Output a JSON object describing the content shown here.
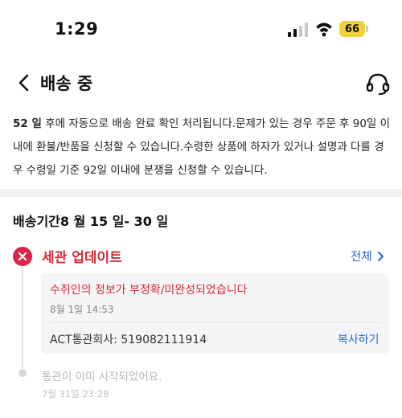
{
  "status_bar": {
    "time": "1:29",
    "battery_level": "66",
    "signal_icon": "cellular-signal-icon",
    "wifi_icon": "wifi-icon",
    "battery_color": "#f1d13c"
  },
  "header": {
    "title": "배송 중",
    "back_icon": "chevron-left-icon",
    "support_icon": "headset-icon"
  },
  "notice": {
    "days_strong": "52 일",
    "text": " 후에 자동으로 배송 완료 확인 처리됩니다.문제가 있는 경우 주문 후 90일 이내에 환불/반품을 신청할 수 있습니다.수령한 상품에 하자가 있거나 설명과 다를 경우 수령일 기준 92일 이내에 분쟁을 신청할 수 있습니다."
  },
  "delivery_period": "배송기간8 월 15 일- 30 일",
  "timeline": {
    "current": {
      "title": "세관 업데이트",
      "view_all": "전체",
      "message": "수취인의 정보가 부정확/미완성되었습니다",
      "date": "8월 1일 14:53",
      "customs_label": "ACT통관회사: 519082111914",
      "copy_label": "복사하기",
      "status_icon": "error-x-icon",
      "accent_color": "#d52b3a"
    },
    "previous": {
      "message": "통관이 이미 시작되었어요.",
      "date": "7월 31일 23:28"
    }
  },
  "colors": {
    "link": "#2a66c9",
    "error": "#d9254b"
  }
}
